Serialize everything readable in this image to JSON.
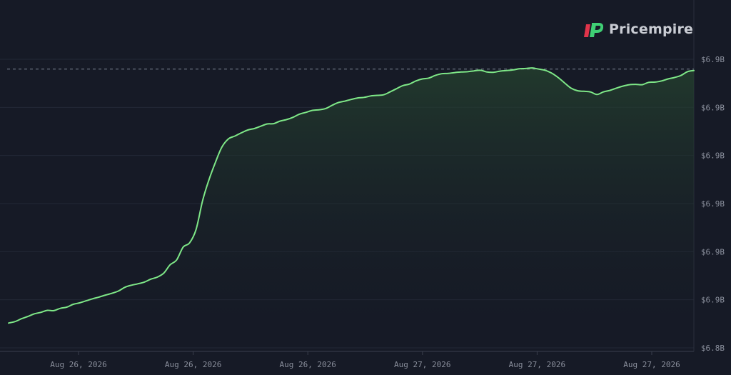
{
  "brand": {
    "name": "Pricempire",
    "logo_colors": {
      "red": "#e0344a",
      "green": "#3fcf74"
    }
  },
  "colors": {
    "background": "#161a26",
    "line": "#7ee787",
    "area_top": "#25432f",
    "grid": "#232837",
    "reference_line": "#7f8693",
    "tick_text": "#8a8f9c"
  },
  "chart_data": {
    "type": "area",
    "title": "",
    "xlabel": "",
    "ylabel": "",
    "x_tick_labels": [
      "Aug 26, 2026",
      "Aug 26, 2026",
      "Aug 26, 2026",
      "Aug 27, 2026",
      "Aug 27, 2026",
      "Aug 27, 2026"
    ],
    "y_tick_labels": [
      "$6.9B",
      "$6.9B",
      "$6.9B",
      "$6.9B",
      "$6.9B",
      "$6.9B",
      "$6.8B"
    ],
    "y_axis_position": "right",
    "grid": "horizontal",
    "ylim": [
      0,
      1
    ],
    "y_unit_note": "normalized 0-1 between lowest and highest y tick",
    "reference_line": {
      "style": "dashed",
      "value": 0.966
    },
    "series": [
      {
        "values": [
          0.086,
          0.091,
          0.101,
          0.109,
          0.118,
          0.123,
          0.13,
          0.129,
          0.137,
          0.141,
          0.151,
          0.156,
          0.163,
          0.17,
          0.176,
          0.183,
          0.189,
          0.197,
          0.21,
          0.217,
          0.222,
          0.228,
          0.238,
          0.245,
          0.259,
          0.288,
          0.305,
          0.349,
          0.364,
          0.41,
          0.509,
          0.583,
          0.643,
          0.696,
          0.724,
          0.734,
          0.745,
          0.755,
          0.76,
          0.768,
          0.776,
          0.777,
          0.786,
          0.791,
          0.799,
          0.81,
          0.816,
          0.823,
          0.825,
          0.829,
          0.84,
          0.85,
          0.855,
          0.861,
          0.866,
          0.868,
          0.873,
          0.875,
          0.877,
          0.887,
          0.898,
          0.909,
          0.914,
          0.925,
          0.932,
          0.935,
          0.944,
          0.95,
          0.951,
          0.954,
          0.956,
          0.957,
          0.96,
          0.962,
          0.956,
          0.955,
          0.959,
          0.961,
          0.963,
          0.967,
          0.968,
          0.97,
          0.966,
          0.962,
          0.952,
          0.937,
          0.918,
          0.9,
          0.891,
          0.889,
          0.887,
          0.878,
          0.887,
          0.892,
          0.9,
          0.907,
          0.912,
          0.913,
          0.912,
          0.92,
          0.921,
          0.925,
          0.932,
          0.937,
          0.944,
          0.957,
          0.961
        ]
      }
    ]
  }
}
